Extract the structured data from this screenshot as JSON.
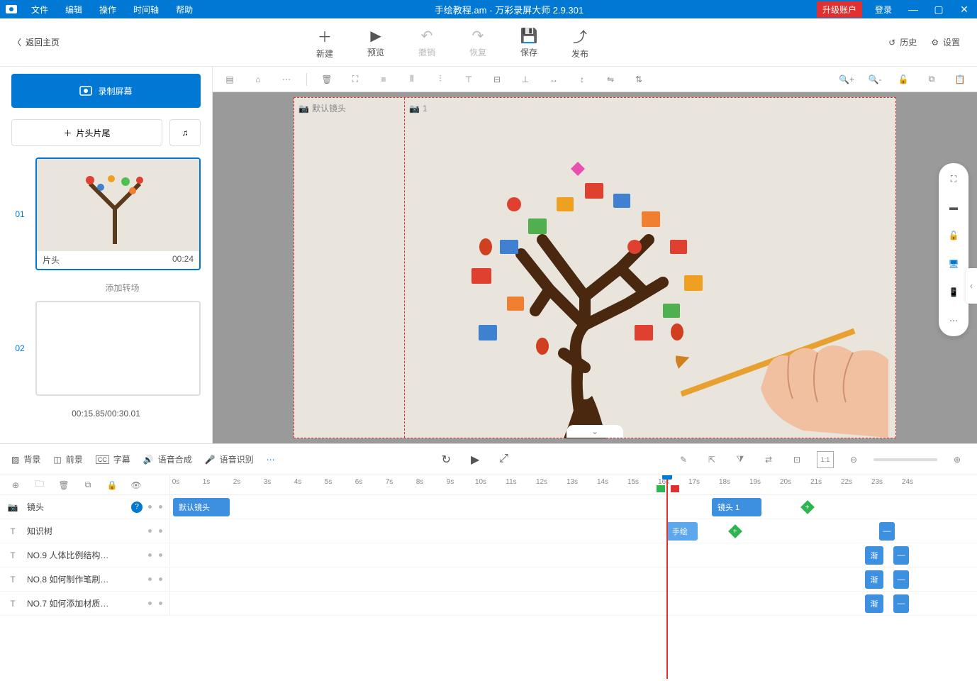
{
  "titlebar": {
    "menus": [
      "文件",
      "编辑",
      "操作",
      "时间轴",
      "帮助"
    ],
    "title": "手绘教程.am - 万彩录屏大师 2.9.301",
    "upgrade": "升级账户",
    "login": "登录"
  },
  "toolbar": {
    "back": "返回主页",
    "actions": [
      {
        "icon": "＋",
        "label": "新建",
        "disabled": false
      },
      {
        "icon": "▶",
        "label": "预览",
        "disabled": false
      },
      {
        "icon": "↶",
        "label": "撤销",
        "disabled": true
      },
      {
        "icon": "↷",
        "label": "恢复",
        "disabled": true
      },
      {
        "icon": "💾",
        "label": "保存",
        "disabled": false
      },
      {
        "icon": "⇧",
        "label": "发布",
        "disabled": false
      }
    ],
    "right": [
      {
        "icon": "history-icon",
        "label": "历史"
      },
      {
        "icon": "gear-icon",
        "label": "设置"
      }
    ]
  },
  "sidebar": {
    "record_label": "录制屏幕",
    "intro_label": "片头片尾",
    "slides": [
      {
        "num": "01",
        "title": "片头",
        "dur": "00:24",
        "active": true
      },
      {
        "num": "02",
        "title": "",
        "dur": "",
        "active": false
      }
    ],
    "add_transition": "添加转场",
    "time_status": "00:15.85/00:30.01"
  },
  "stage": {
    "default_camera": "默认镜头",
    "camera_num": "1"
  },
  "timeline": {
    "tools": [
      {
        "icon": "▨",
        "label": "背景"
      },
      {
        "icon": "◫",
        "label": "前景"
      },
      {
        "icon": "CC",
        "label": "字幕"
      },
      {
        "icon": "🔊",
        "label": "语音合成"
      },
      {
        "icon": "🎤",
        "label": "语音识别"
      }
    ],
    "ticks": [
      "0s",
      "1s",
      "2s",
      "3s",
      "4s",
      "5s",
      "6s",
      "7s",
      "8s",
      "9s",
      "10s",
      "11s",
      "12s",
      "13s",
      "14s",
      "15s",
      "16s",
      "17s",
      "18s",
      "19s",
      "20s",
      "21s",
      "22s",
      "23s",
      "24s"
    ],
    "tracks": [
      {
        "icon": "📷",
        "name": "镜头",
        "help": true
      },
      {
        "icon": "T",
        "name": "知识树"
      },
      {
        "icon": "T",
        "name": "NO.9  人体比例结构…"
      },
      {
        "icon": "T",
        "name": "NO.8  如何制作笔刷…"
      },
      {
        "icon": "T",
        "name": "NO.7  如何添加材质…"
      }
    ],
    "clip_default": "默认镜头",
    "clip_camera1": "镜头 1",
    "clip_handdraw": "手绘",
    "clip_gradient": "渐"
  }
}
